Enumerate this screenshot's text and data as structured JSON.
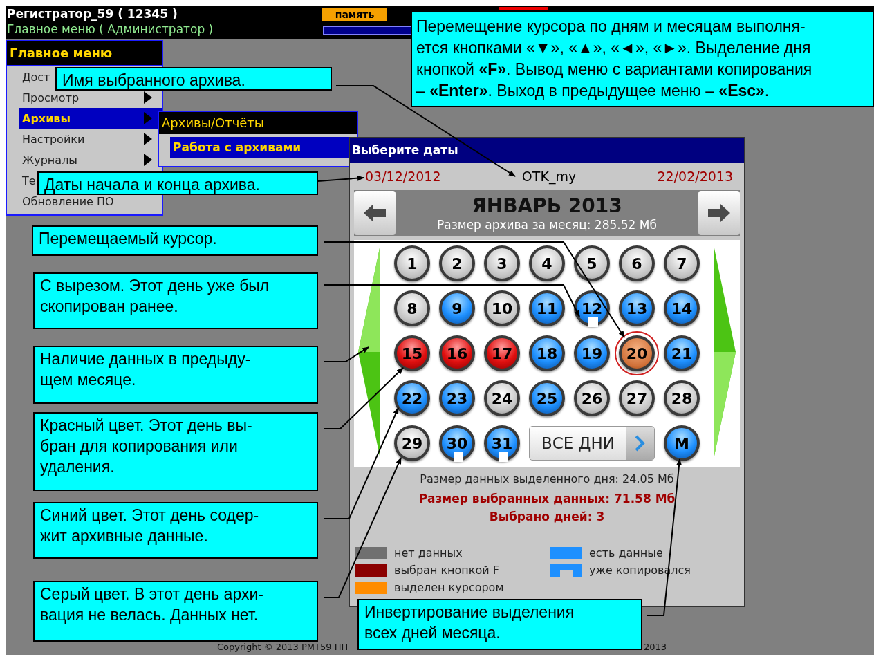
{
  "header": {
    "title": "Регистратор_59 ( 12345 )",
    "subtitle": "Главное меню ( Администратор )",
    "badge": "память"
  },
  "main_menu": {
    "title": "Главное меню",
    "items": [
      {
        "label": "Дост",
        "selected": false
      },
      {
        "label": "Просмотр",
        "selected": false,
        "submenu": true
      },
      {
        "label": "Архивы",
        "selected": true,
        "submenu": true
      },
      {
        "label": "Настройки",
        "selected": false,
        "submenu": true
      },
      {
        "label": "Журналы",
        "selected": false,
        "submenu": true
      },
      {
        "label": "Те",
        "selected": false
      },
      {
        "label": "Обновление ПО",
        "selected": false,
        "submenu": false
      }
    ]
  },
  "submenu": {
    "title": "Архивы/Отчёты",
    "items": [
      {
        "label": "Работа с архивами",
        "selected": true
      }
    ]
  },
  "dialog": {
    "title": "Выберите даты",
    "start_date": "03/12/2012",
    "archive_name": "OTK_my",
    "end_date": "22/02/2013",
    "month": "ЯНВАРЬ 2013",
    "month_size": "Размер архива за месяц: 285.52 Мб",
    "prev_month_has_data": true,
    "next_month_has_data": true,
    "days": [
      {
        "label": "1",
        "kind": "none",
        "copied": false
      },
      {
        "label": "2",
        "kind": "none",
        "copied": false
      },
      {
        "label": "3",
        "kind": "none",
        "copied": false
      },
      {
        "label": "4",
        "kind": "none",
        "copied": false
      },
      {
        "label": "5",
        "kind": "none",
        "copied": false
      },
      {
        "label": "6",
        "kind": "none",
        "copied": false
      },
      {
        "label": "7",
        "kind": "none",
        "copied": false
      },
      {
        "label": "8",
        "kind": "none",
        "copied": false
      },
      {
        "label": "9",
        "kind": "data",
        "copied": false
      },
      {
        "label": "10",
        "kind": "none",
        "copied": false
      },
      {
        "label": "11",
        "kind": "data",
        "copied": false
      },
      {
        "label": "12",
        "kind": "data",
        "copied": true
      },
      {
        "label": "13",
        "kind": "data",
        "copied": false
      },
      {
        "label": "14",
        "kind": "data",
        "copied": false
      },
      {
        "label": "15",
        "kind": "selected",
        "copied": false
      },
      {
        "label": "16",
        "kind": "selected",
        "copied": false
      },
      {
        "label": "17",
        "kind": "selected",
        "copied": false
      },
      {
        "label": "18",
        "kind": "data",
        "copied": false
      },
      {
        "label": "19",
        "kind": "data",
        "copied": false
      },
      {
        "label": "20",
        "kind": "cursor",
        "copied": false
      },
      {
        "label": "21",
        "kind": "data",
        "copied": false
      },
      {
        "label": "22",
        "kind": "data",
        "copied": false
      },
      {
        "label": "23",
        "kind": "data",
        "copied": false
      },
      {
        "label": "24",
        "kind": "none",
        "copied": false
      },
      {
        "label": "25",
        "kind": "data",
        "copied": false
      },
      {
        "label": "26",
        "kind": "none",
        "copied": false
      },
      {
        "label": "27",
        "kind": "none",
        "copied": false
      },
      {
        "label": "28",
        "kind": "none",
        "copied": false
      },
      {
        "label": "29",
        "kind": "none",
        "copied": false
      },
      {
        "label": "30",
        "kind": "data",
        "copied": true
      },
      {
        "label": "31",
        "kind": "data",
        "copied": true
      }
    ],
    "all_days_button": "ВСЕ ДНИ",
    "invert_button": "M",
    "day_size": "Размер данных выделенного дня: 24.05 Мб",
    "selected_size": "Размер выбранных данных: 71.58 Мб",
    "selected_count": "Выбрано дней: 3",
    "legend": [
      {
        "label": "нет данных",
        "color": "#707070",
        "kind": "solid"
      },
      {
        "label": "есть данные",
        "color": "#1e90ff",
        "kind": "solid"
      },
      {
        "label": "выбран кнопкой F",
        "color": "#8b0000",
        "kind": "solid"
      },
      {
        "label": "уже копировался",
        "color": "#1e90ff",
        "kind": "notched"
      },
      {
        "label": "выделен курсором",
        "color": "#ff8c00",
        "kind": "solid"
      }
    ]
  },
  "copyright": [
    "Copyright © 2013 PMT59 НП",
    "2013"
  ],
  "callouts": [
    {
      "text": " Перемещение курсора по дням и месяцам выполня-\nется кнопками «▼», «▲», «◄»,  «►». Выделение дня\nкнопкой **«F»**. Вывод меню с вариантами копирования\n– **«Enter»**. Выход в предыдущее меню – **«Esc»**."
    },
    {
      "text": "Имя выбранного архива."
    },
    {
      "text": "Даты начала и конца архива."
    },
    {
      "text": "Перемещаемый курсор."
    },
    {
      "text": "С вырезом. Этот день уже был\nскопирован ранее."
    },
    {
      "text": "Наличие данных в предыду-\nщем месяце."
    },
    {
      "text": "Красный цвет. Этот день вы-\nбран для копирования или\nудаления."
    },
    {
      "text": "Синий цвет. Этот день содер-\nжит архивные данные."
    },
    {
      "text": "Серый цвет. В этот день архи-\nвация не велась. Данных нет."
    },
    {
      "text": "Инвертирование выделения\nвсех дней месяца."
    }
  ]
}
